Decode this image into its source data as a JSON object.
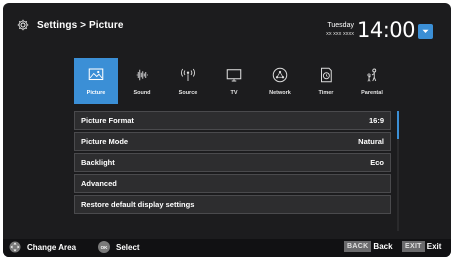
{
  "header": {
    "breadcrumb": "Settings > Picture",
    "day": "Tuesday",
    "date": "xx xxx xxxx",
    "time": "14:00"
  },
  "tabs": [
    {
      "label": "Picture",
      "icon": "picture-icon",
      "selected": true
    },
    {
      "label": "Sound",
      "icon": "sound-icon",
      "selected": false
    },
    {
      "label": "Source",
      "icon": "source-icon",
      "selected": false
    },
    {
      "label": "TV",
      "icon": "tv-icon",
      "selected": false
    },
    {
      "label": "Network",
      "icon": "network-icon",
      "selected": false
    },
    {
      "label": "Timer",
      "icon": "timer-icon",
      "selected": false
    },
    {
      "label": "Parental",
      "icon": "parental-icon",
      "selected": false
    }
  ],
  "rows": [
    {
      "label": "Picture Format",
      "value": "16:9"
    },
    {
      "label": "Picture Mode",
      "value": "Natural"
    },
    {
      "label": "Backlight",
      "value": "Eco"
    },
    {
      "label": "Advanced",
      "value": ""
    },
    {
      "label": "Restore default display settings",
      "value": ""
    }
  ],
  "footer": {
    "change_area": "Change Area",
    "ok_key": "OK",
    "select": "Select",
    "back_key": "BACK",
    "back": "Back",
    "exit_key": "EXIT",
    "exit": "Exit"
  },
  "colors": {
    "accent": "#3b8fd6",
    "background": "#1c1c1e",
    "row": "#2d2d2f"
  }
}
